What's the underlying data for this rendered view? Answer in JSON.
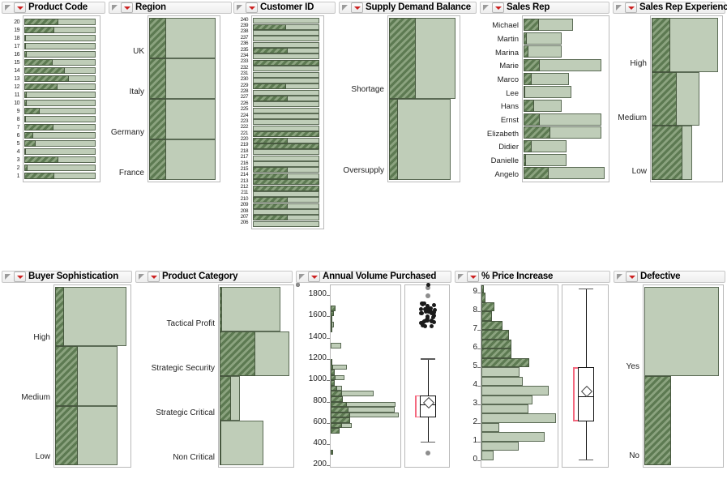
{
  "window": {
    "title": "Data Filter Distributions",
    "theme": {
      "selected_fill": "#5d7a52",
      "unselected_fill": "#bfcdb8",
      "panel_header_bg": "#f1f1f1",
      "red_accent": "#cc2222",
      "red_bracket": "#f4697f"
    }
  },
  "panels": [
    {
      "id": "product-code",
      "title": "Product Code",
      "type": "bar",
      "icons": [
        "disclosure-triangle-icon",
        "red-dropdown-icon"
      ],
      "categories": [
        "20",
        "19",
        "18",
        "17",
        "16",
        "15",
        "14",
        "13",
        "12",
        "11",
        "10",
        "9",
        "8",
        "7",
        "6",
        "5",
        "4",
        "3",
        "2",
        "1"
      ],
      "total": [
        1,
        1,
        1,
        1,
        1,
        1,
        1,
        1,
        1,
        1,
        1,
        1,
        1,
        1,
        1,
        1,
        1,
        1,
        1,
        1
      ],
      "selected_fraction": [
        0.48,
        0.42,
        0.02,
        0.02,
        0.03,
        0.4,
        0.57,
        0.62,
        0.47,
        0.03,
        0.03,
        0.22,
        0.02,
        0.41,
        0.13,
        0.16,
        0.01,
        0.48,
        0.04,
        0.42
      ]
    },
    {
      "id": "region",
      "title": "Region",
      "type": "bar",
      "icons": [
        "disclosure-triangle-icon",
        "red-dropdown-icon"
      ],
      "categories": [
        "UK",
        "Italy",
        "Germany",
        "France"
      ],
      "total": [
        1,
        1,
        1,
        1
      ],
      "selected_fraction": [
        0.26,
        0.26,
        0.26,
        0.26
      ]
    },
    {
      "id": "customer-id",
      "title": "Customer ID",
      "type": "bar",
      "icons": [
        "disclosure-triangle-icon",
        "red-dropdown-icon"
      ],
      "categories": [
        "240",
        "239",
        "238",
        "237",
        "236",
        "235",
        "234",
        "233",
        "232",
        "231",
        "230",
        "229",
        "228",
        "227",
        "226",
        "225",
        "224",
        "223",
        "222",
        "221",
        "220",
        "219",
        "218",
        "217",
        "216",
        "215",
        "214",
        "213",
        "212",
        "211",
        "210",
        "209",
        "208",
        "207",
        "206"
      ],
      "total": [
        1,
        1,
        1,
        1,
        1,
        1,
        1,
        1,
        1,
        1,
        1,
        1,
        1,
        1,
        1,
        1,
        1,
        1,
        1,
        1,
        1,
        1,
        1,
        1,
        1,
        1,
        1,
        1,
        1,
        1,
        1,
        1,
        1,
        1,
        1
      ],
      "selected_fraction": [
        0.0,
        0.5,
        0.0,
        0.0,
        0.0,
        0.52,
        0.0,
        1.0,
        0.0,
        0.0,
        0.0,
        0.5,
        0.0,
        0.52,
        0.0,
        0.0,
        0.0,
        0.0,
        0.0,
        1.0,
        0.52,
        1.0,
        0.0,
        0.0,
        0.0,
        0.52,
        0.52,
        1.0,
        1.0,
        0.0,
        0.52,
        0.52,
        0.0,
        0.52,
        0.0
      ]
    },
    {
      "id": "supply-demand-balance",
      "title": "Supply Demand Balance",
      "type": "bar",
      "icons": [
        "disclosure-triangle-icon",
        "red-dropdown-icon"
      ],
      "categories": [
        "Shortage",
        "Oversupply"
      ],
      "total": [
        1.0,
        0.93
      ],
      "selected_fraction": [
        0.4,
        0.13
      ]
    },
    {
      "id": "sales-rep",
      "title": "Sales Rep",
      "type": "bar",
      "icons": [
        "disclosure-triangle-icon",
        "red-dropdown-icon"
      ],
      "categories": [
        "Michael",
        "Martin",
        "Marina",
        "Marie",
        "Marco",
        "Lee",
        "Hans",
        "Ernst",
        "Elizabeth",
        "Didier",
        "Danielle",
        "Angelo"
      ],
      "total": [
        0.55,
        0.42,
        0.42,
        0.86,
        0.5,
        0.53,
        0.42,
        0.86,
        0.86,
        0.48,
        0.48,
        0.9
      ],
      "selected_fraction": [
        0.17,
        0.04,
        0.05,
        0.18,
        0.09,
        0.02,
        0.12,
        0.18,
        0.3,
        0.09,
        0.03,
        0.28
      ]
    },
    {
      "id": "sales-rep-experience",
      "title": "Sales Rep Experience",
      "type": "bar",
      "icons": [
        "disclosure-triangle-icon",
        "red-dropdown-icon"
      ],
      "categories": [
        "High",
        "Medium",
        "Low"
      ],
      "total": [
        1.0,
        0.72,
        0.61
      ],
      "selected_fraction": [
        0.28,
        0.38,
        0.46
      ]
    },
    {
      "id": "buyer-sophistication",
      "title": "Buyer Sophistication",
      "type": "bar",
      "icons": [
        "disclosure-triangle-icon",
        "red-dropdown-icon"
      ],
      "categories": [
        "High",
        "Medium",
        "Low"
      ],
      "total": [
        1.0,
        0.88,
        0.87
      ],
      "selected_fraction": [
        0.12,
        0.32,
        0.32
      ]
    },
    {
      "id": "product-category",
      "title": "Product Category",
      "type": "bar",
      "icons": [
        "disclosure-triangle-icon",
        "red-dropdown-icon"
      ],
      "categories": [
        "Tactical Profit",
        "Strategic Security",
        "Strategic Critical",
        "Non Critical"
      ],
      "total": [
        0.86,
        0.98,
        0.29,
        0.62
      ],
      "selected_fraction": [
        0.03,
        0.5,
        0.16,
        0.02
      ]
    },
    {
      "id": "annual-volume-purchased",
      "title": "Annual Volume Purchased",
      "type": "histogram",
      "icons": [
        "disclosure-triangle-icon",
        "red-dropdown-icon"
      ],
      "axis": {
        "ticks": [
          1800,
          1600,
          1400,
          1200,
          1000,
          800,
          600,
          400,
          200
        ],
        "min": 180,
        "max": 1900
      },
      "bins": [
        {
          "from": 1650,
          "to": 1700,
          "count": 0.07,
          "selected": 0.07
        },
        {
          "from": 1600,
          "to": 1650,
          "count": 0.05,
          "selected": 0.05
        },
        {
          "from": 1550,
          "to": 1600,
          "count": 0.03,
          "selected": 0.03
        },
        {
          "from": 1500,
          "to": 1550,
          "count": 0.05,
          "selected": 0.03
        },
        {
          "from": 1450,
          "to": 1500,
          "count": 0.03,
          "selected": 0.03
        },
        {
          "from": 1300,
          "to": 1350,
          "count": 0.16,
          "selected": 0.0
        },
        {
          "from": 1150,
          "to": 1200,
          "count": 0.03,
          "selected": 0.03
        },
        {
          "from": 1100,
          "to": 1150,
          "count": 0.25,
          "selected": 0.04
        },
        {
          "from": 1050,
          "to": 1100,
          "count": 0.06,
          "selected": 0.06
        },
        {
          "from": 1000,
          "to": 1050,
          "count": 0.21,
          "selected": 0.08
        },
        {
          "from": 950,
          "to": 1000,
          "count": 0.06,
          "selected": 0.06
        },
        {
          "from": 900,
          "to": 950,
          "count": 0.18,
          "selected": 0.1
        },
        {
          "from": 850,
          "to": 900,
          "count": 0.66,
          "selected": 0.17
        },
        {
          "from": 800,
          "to": 850,
          "count": 0.19,
          "selected": 0.19
        },
        {
          "from": 750,
          "to": 800,
          "count": 1.0,
          "selected": 0.25
        },
        {
          "from": 700,
          "to": 750,
          "count": 0.99,
          "selected": 0.28
        },
        {
          "from": 650,
          "to": 700,
          "count": 1.05,
          "selected": 0.3
        },
        {
          "from": 600,
          "to": 650,
          "count": 0.3,
          "selected": 0.3
        },
        {
          "from": 550,
          "to": 600,
          "count": 0.33,
          "selected": 0.18
        },
        {
          "from": 500,
          "to": 550,
          "count": 0.14,
          "selected": 0.14
        },
        {
          "from": 300,
          "to": 350,
          "count": 0.04,
          "selected": 0.04
        }
      ],
      "boxplot": {
        "min": 425,
        "q1": 650,
        "median": 775,
        "q3": 860,
        "max": 1205,
        "mean": 800,
        "outliers_low": [
          315
        ],
        "outliers_high": [
          1870,
          1790
        ]
      },
      "has_dotplot": true
    },
    {
      "id": "percent-price-increase",
      "title": "% Price Increase",
      "type": "histogram",
      "icons": [
        "disclosure-triangle-icon",
        "red-dropdown-icon"
      ],
      "axis": {
        "ticks": [
          9,
          8,
          7,
          6,
          5,
          4,
          3,
          2,
          1,
          0
        ],
        "min": -0.4,
        "max": 9.45
      },
      "bins": [
        {
          "from": 9.0,
          "to": 9.4,
          "count": 0.03,
          "selected": 0.03
        },
        {
          "from": 8.5,
          "to": 9.0,
          "count": 0.05,
          "selected": 0.05
        },
        {
          "from": 8.0,
          "to": 8.5,
          "count": 0.17,
          "selected": 0.17
        },
        {
          "from": 7.5,
          "to": 8.0,
          "count": 0.14,
          "selected": 0.14
        },
        {
          "from": 7.0,
          "to": 7.5,
          "count": 0.28,
          "selected": 0.28
        },
        {
          "from": 6.5,
          "to": 7.0,
          "count": 0.37,
          "selected": 0.37
        },
        {
          "from": 6.0,
          "to": 6.5,
          "count": 0.4,
          "selected": 0.4
        },
        {
          "from": 5.5,
          "to": 6.0,
          "count": 0.4,
          "selected": 0.4
        },
        {
          "from": 5.0,
          "to": 5.5,
          "count": 0.64,
          "selected": 0.64
        },
        {
          "from": 4.5,
          "to": 5.0,
          "count": 0.51,
          "selected": 0.0
        },
        {
          "from": 4.0,
          "to": 4.5,
          "count": 0.55,
          "selected": 0.0
        },
        {
          "from": 3.5,
          "to": 4.0,
          "count": 0.9,
          "selected": 0.0
        },
        {
          "from": 3.0,
          "to": 3.5,
          "count": 0.69,
          "selected": 0.0
        },
        {
          "from": 2.5,
          "to": 3.0,
          "count": 0.63,
          "selected": 0.0
        },
        {
          "from": 2.0,
          "to": 2.5,
          "count": 1.0,
          "selected": 0.0
        },
        {
          "from": 1.5,
          "to": 2.0,
          "count": 0.24,
          "selected": 0.0
        },
        {
          "from": 1.0,
          "to": 1.5,
          "count": 0.85,
          "selected": 0.0
        },
        {
          "from": 0.5,
          "to": 1.0,
          "count": 0.5,
          "selected": 0.0
        },
        {
          "from": 0.0,
          "to": 0.5,
          "count": 0.16,
          "selected": 0.0
        }
      ],
      "boxplot": {
        "min": 0.05,
        "q1": 2.1,
        "median": 3.45,
        "q3": 5.0,
        "max": 9.25,
        "mean": 3.75
      },
      "has_dotplot": false
    },
    {
      "id": "defective",
      "title": "Defective",
      "type": "bar",
      "icons": [
        "disclosure-triangle-icon",
        "red-dropdown-icon"
      ],
      "categories": [
        "Yes",
        "No"
      ],
      "total": [
        1.0,
        0.36
      ],
      "selected_fraction": [
        0.0,
        0.36
      ]
    }
  ]
}
